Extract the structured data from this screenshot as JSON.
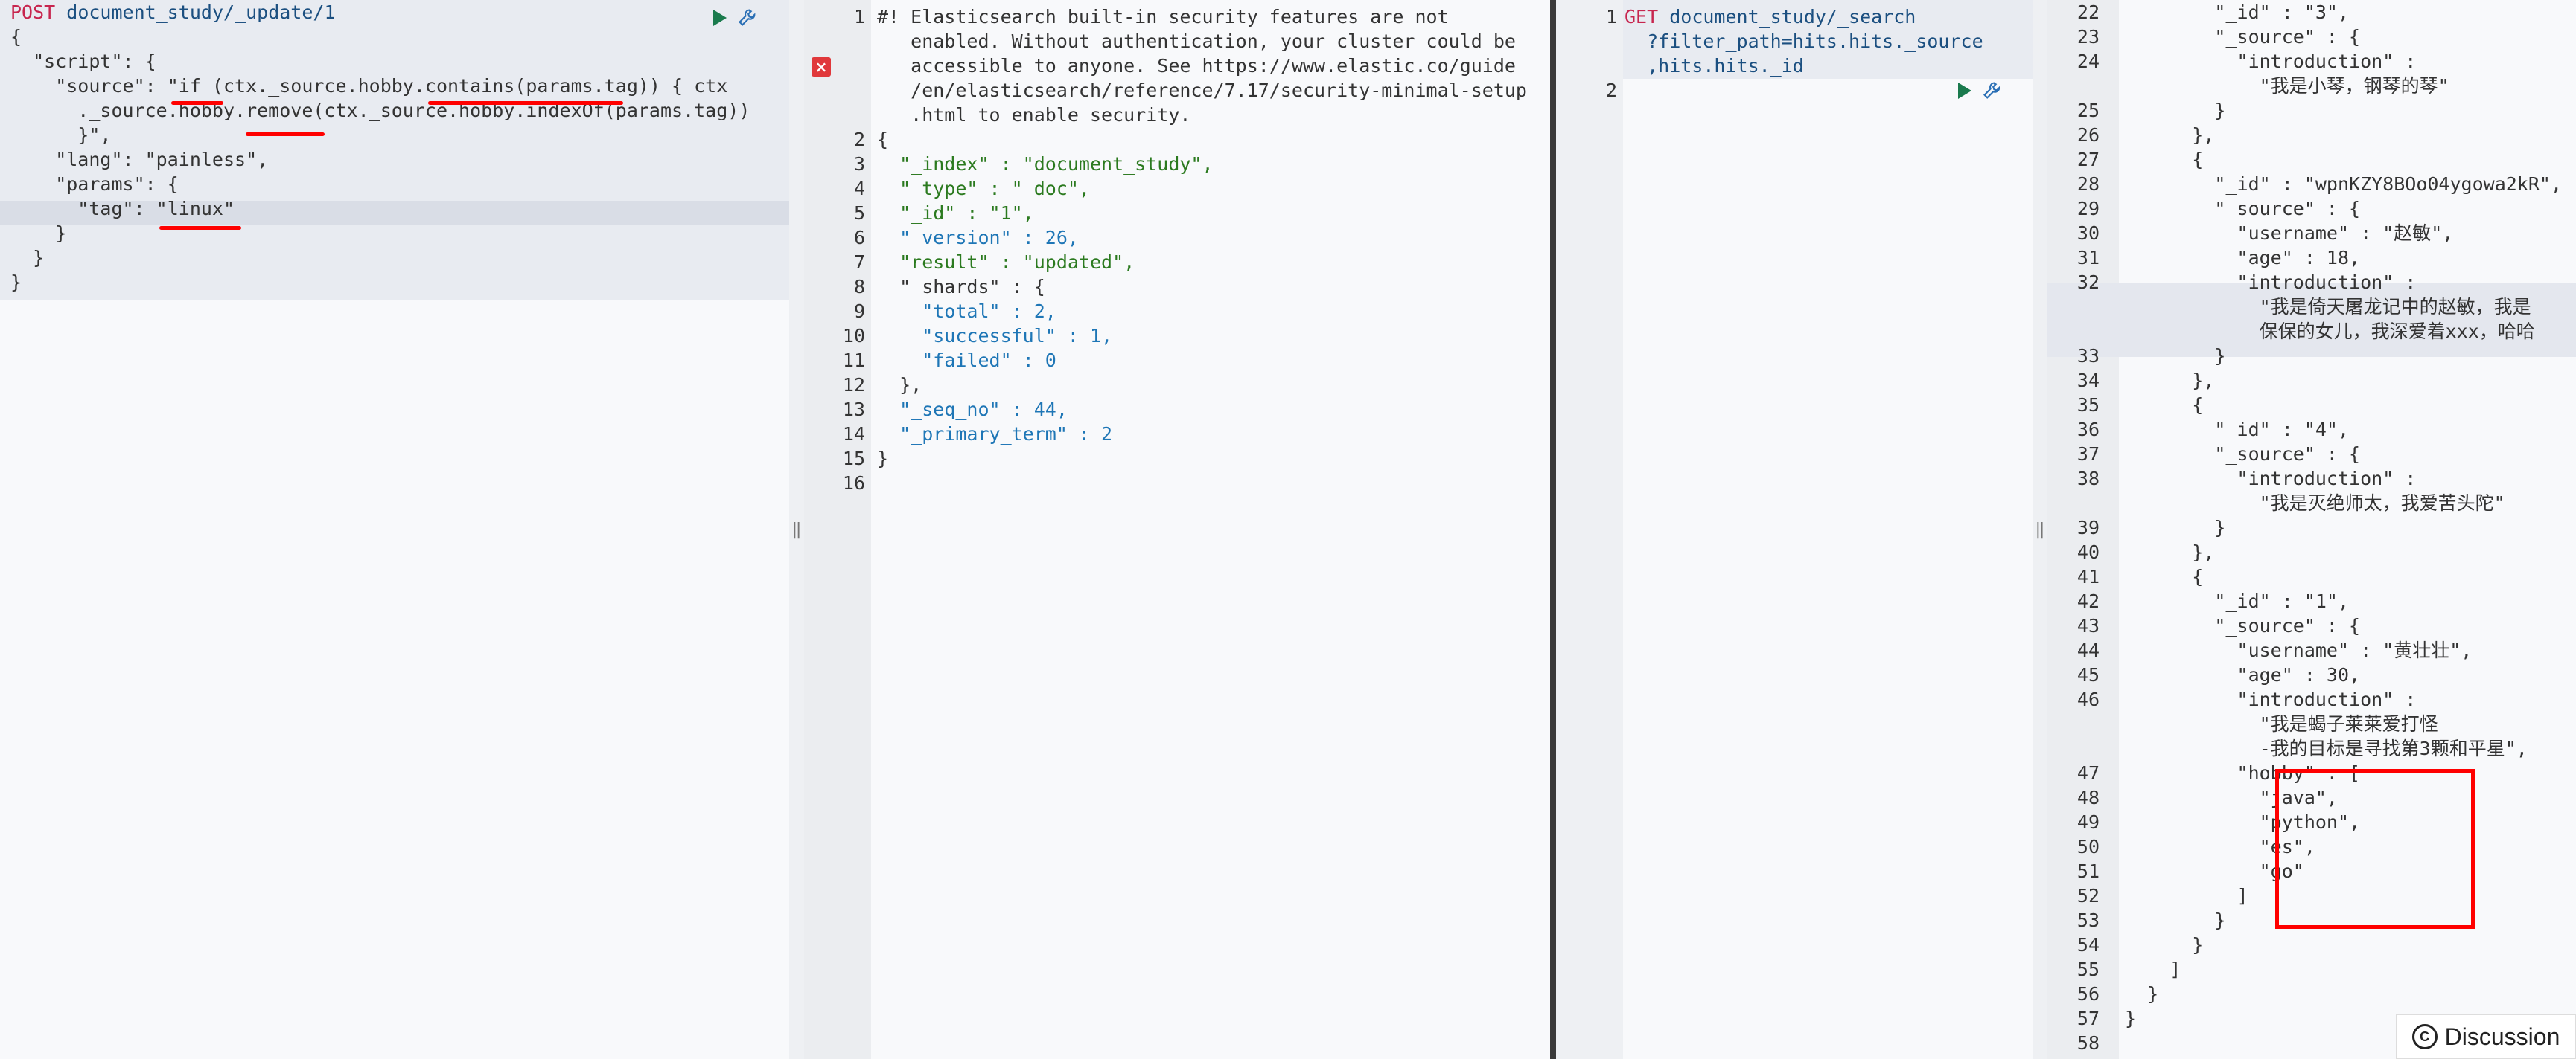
{
  "left_window": {
    "request": {
      "method": "POST",
      "endpoint": "document_study/_update/1",
      "lines": [
        "{",
        "  \"script\": {",
        "    \"source\": \"if (ctx._source.hobby.contains(params.tag)) { ctx",
        "      ._source.hobby.remove(ctx._source.hobby.indexOf(params.tag))",
        "      }\",",
        "    \"lang\": \"painless\",",
        "    \"params\": {",
        "      \"tag\": \"linux\"",
        "    }",
        "  }",
        "}"
      ]
    },
    "response": {
      "line_numbers": [
        "1",
        "",
        "",
        "",
        "",
        "2",
        "3",
        "4",
        "5",
        "6",
        "7",
        "8",
        "9",
        "10",
        "11",
        "12",
        "13",
        "14",
        "15",
        "16"
      ],
      "lines": [
        "#! Elasticsearch built-in security features are not",
        "   enabled. Without authentication, your cluster could be",
        "   accessible to anyone. See https://www.elastic.co/guide",
        "   /en/elasticsearch/reference/7.17/security-minimal-setup",
        "   .html to enable security.",
        "{",
        "  \"_index\" : \"document_study\",",
        "  \"_type\" : \"_doc\",",
        "  \"_id\" : \"1\",",
        "  \"_version\" : 26,",
        "  \"result\" : \"updated\",",
        "  \"_shards\" : {",
        "    \"total\" : 2,",
        "    \"successful\" : 1,",
        "    \"failed\" : 0",
        "  },",
        "  \"_seq_no\" : 44,",
        "  \"_primary_term\" : 2",
        "}",
        ""
      ]
    }
  },
  "right_window": {
    "request": {
      "line_numbers": [
        "1",
        "",
        "",
        "2"
      ],
      "method": "GET",
      "endpoint_lines": [
        "document_study/_search",
        "  ?filter_path=hits.hits._source",
        "  ,hits.hits._id"
      ]
    },
    "response": {
      "line_numbers": [
        "22",
        "23",
        "24",
        "",
        "25",
        "26",
        "27",
        "28",
        "29",
        "30",
        "31",
        "32",
        "",
        "",
        "33",
        "34",
        "35",
        "36",
        "37",
        "38",
        "",
        "39",
        "40",
        "41",
        "42",
        "43",
        "44",
        "45",
        "46",
        "",
        "",
        "47",
        "48",
        "49",
        "50",
        "51",
        "52",
        "53",
        "54",
        "55",
        "56",
        "57",
        "58"
      ],
      "lines": [
        "        \"_id\" : \"3\",",
        "        \"_source\" : {",
        "          \"introduction\" :",
        "            \"我是小琴，钢琴的琴\"",
        "        }",
        "      },",
        "      {",
        "        \"_id\" : \"wpnKZY8BOo04ygowa2kR\",",
        "        \"_source\" : {",
        "          \"username\" : \"赵敏\",",
        "          \"age\" : 18,",
        "          \"introduction\" :",
        "            \"我是倚天屠龙记中的赵敏，我是",
        "            保保的女儿，我深爱着xxx，哈哈",
        "        }",
        "      },",
        "      {",
        "        \"_id\" : \"4\",",
        "        \"_source\" : {",
        "          \"introduction\" :",
        "            \"我是灭绝师太，我爱苦头陀\"",
        "        }",
        "      },",
        "      {",
        "        \"_id\" : \"1\",",
        "        \"_source\" : {",
        "          \"username\" : \"黄壮壮\",",
        "          \"age\" : 30,",
        "          \"introduction\" :",
        "            \"我是蝎子莱莱爱打怪",
        "            -我的目标是寻找第3颗和平星\",",
        "          \"hobby\" : [",
        "            \"java\",",
        "            \"python\",",
        "            \"es\",",
        "            \"go\"",
        "          ]",
        "        }",
        "      }",
        "    ]",
        "  }",
        "}",
        ""
      ]
    }
  },
  "discussion_label": "Discussion",
  "resize_handle_glyph": "‖",
  "error_glyph": "×",
  "discussion_glyph": "C",
  "colors": {
    "annotation_red": "#ff0000",
    "play_green": "#1a7a4d",
    "method_red": "#c7254e"
  }
}
